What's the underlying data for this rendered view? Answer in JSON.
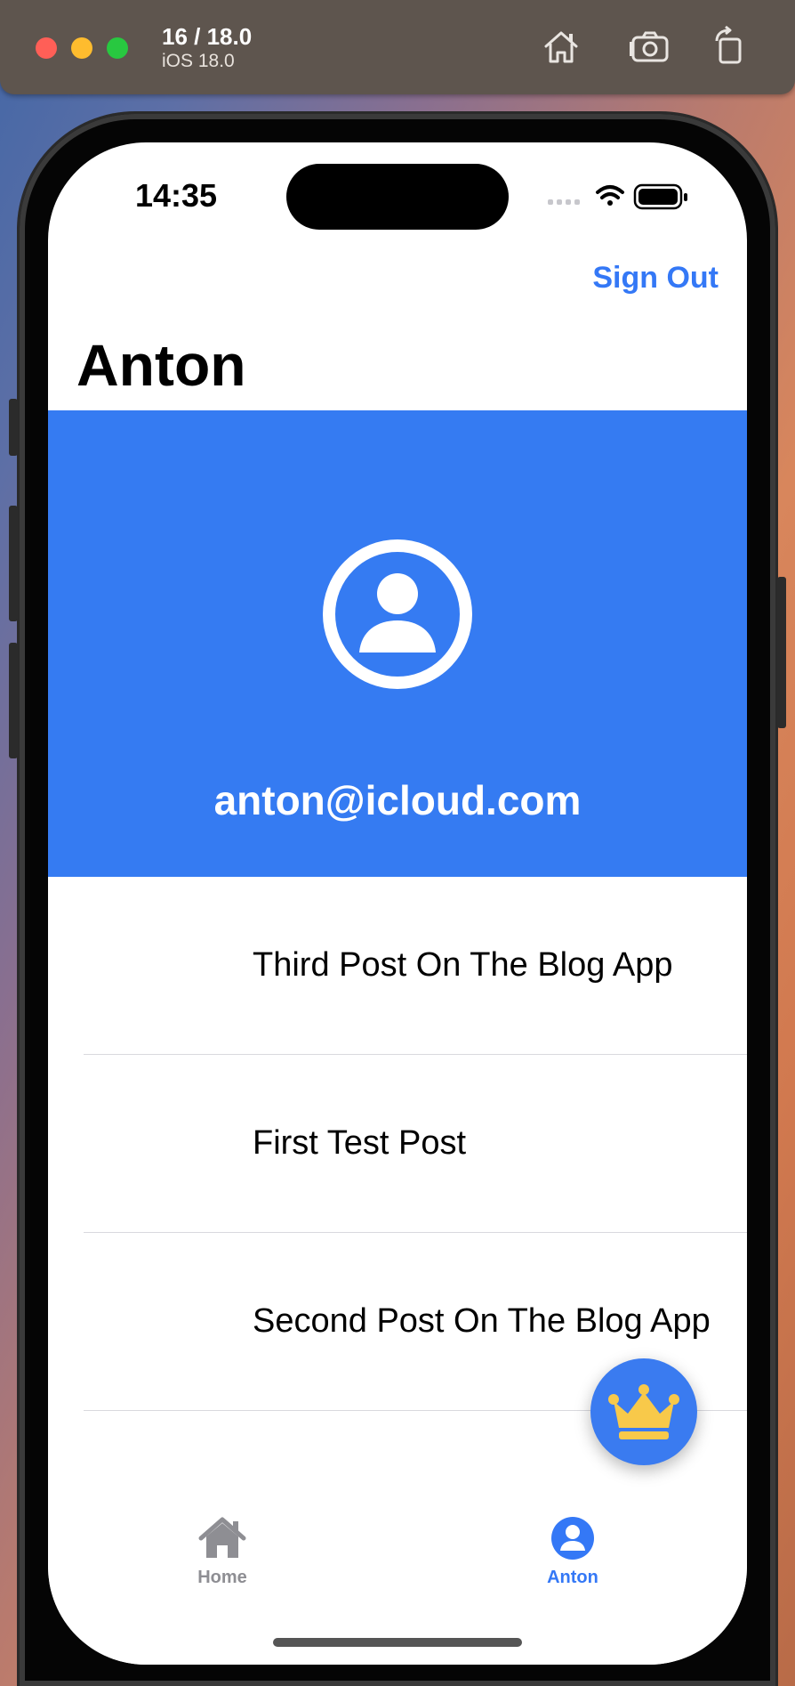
{
  "simulator": {
    "title": "16 / 18.0",
    "subtitle": "iOS 18.0",
    "icons": [
      "home-icon",
      "screenshot-icon",
      "rotate-icon"
    ]
  },
  "status_bar": {
    "time": "14:35",
    "icons": [
      "signal-icon",
      "wifi-icon",
      "battery-icon"
    ]
  },
  "nav": {
    "sign_out_label": "Sign Out",
    "title": "Anton"
  },
  "profile": {
    "email": "anton@icloud.com",
    "avatar_icon": "person-circle-icon",
    "header_color": "#357bf2"
  },
  "posts": [
    {
      "title": "Third Post On The Blog App"
    },
    {
      "title": "First Test Post"
    },
    {
      "title": "Second Post On The Blog App"
    }
  ],
  "fab": {
    "icon": "crown-icon",
    "color": "#3a7bf0",
    "icon_color": "#f8c94a"
  },
  "tabbar": {
    "tabs": [
      {
        "label": "Home",
        "icon": "house-icon",
        "selected": false
      },
      {
        "label": "Anton",
        "icon": "person-circle-icon",
        "selected": true
      }
    ],
    "accent": "#3478f6",
    "inactive": "#8e8e93"
  }
}
